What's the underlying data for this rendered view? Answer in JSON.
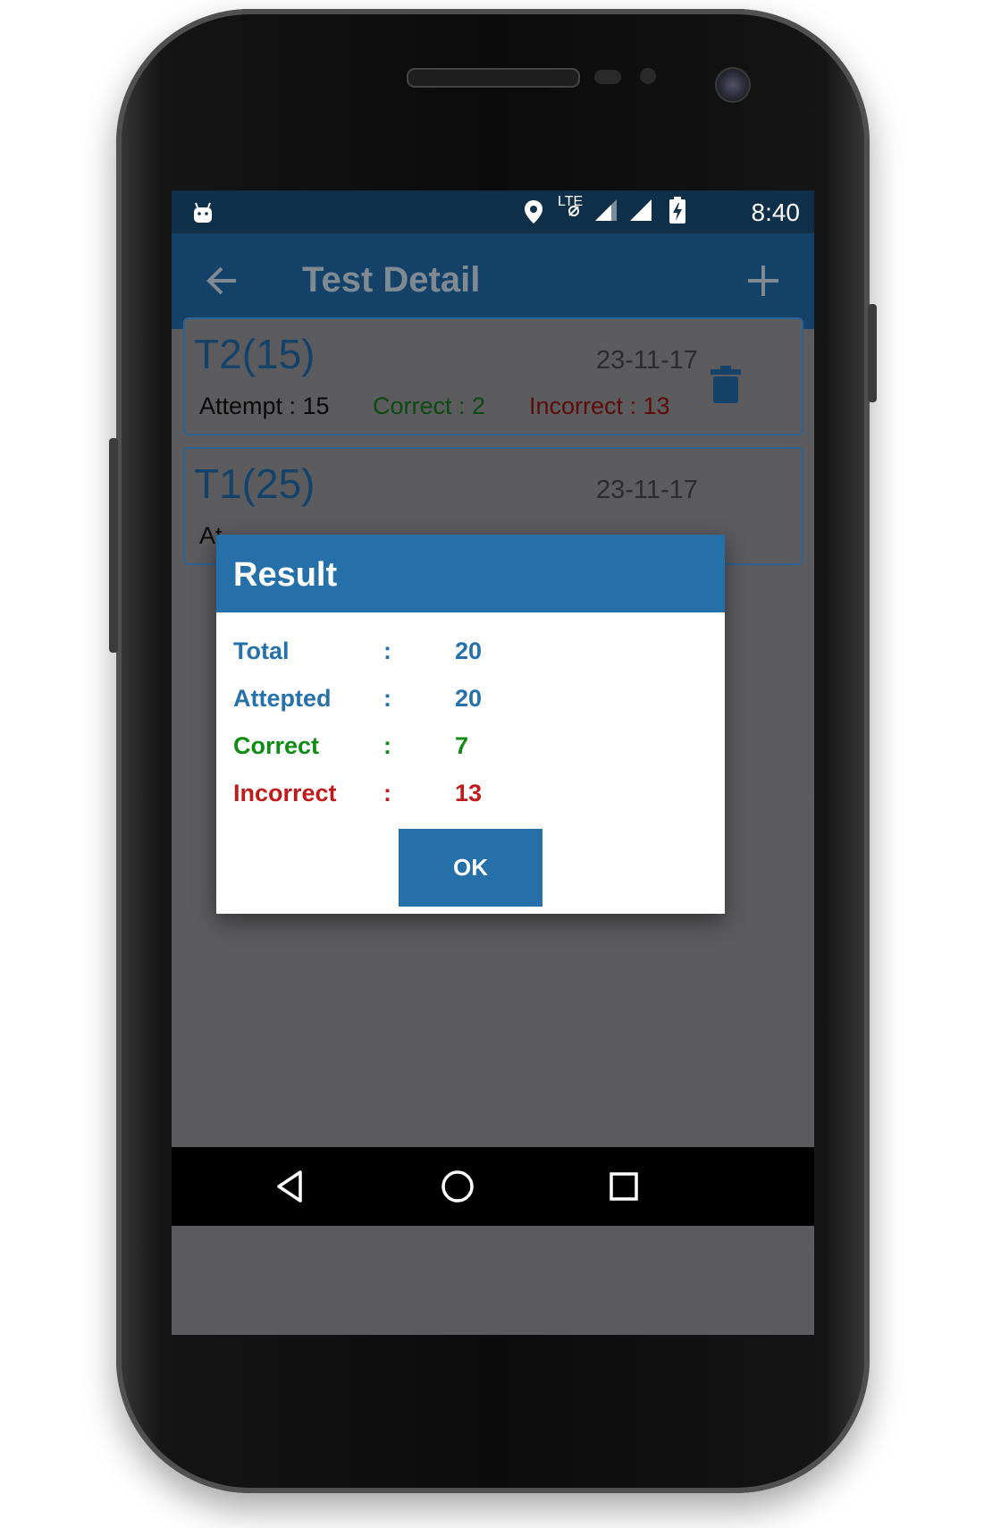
{
  "status_bar": {
    "time": "8:40",
    "network_label": "LTE",
    "icons": [
      "android-icon",
      "location-icon",
      "lte-icon",
      "signal-icon",
      "signal-full-icon",
      "battery-charging-icon"
    ]
  },
  "appbar": {
    "title": "Test Detail",
    "back_icon": "arrow-left-icon",
    "add_icon": "plus-icon"
  },
  "tests": [
    {
      "name": "T2(15)",
      "date": "23-11-17",
      "attempt": "Attempt : 15",
      "correct": "Correct : 2",
      "incorrect": "Incorrect : 13"
    },
    {
      "name": "T1(25)",
      "date": "23-11-17",
      "attempt": "At"
    }
  ],
  "dialog": {
    "title": "Result",
    "separator": ":",
    "rows": [
      {
        "label": "Total",
        "value": "20",
        "color": "#2671a9"
      },
      {
        "label": "Attepted",
        "value": "20",
        "color": "#2671a9"
      },
      {
        "label": "Correct",
        "value": "7",
        "color": "#0f8c13"
      },
      {
        "label": "Incorrect",
        "value": "13",
        "color": "#bf1b1b"
      }
    ],
    "ok_label": "OK"
  },
  "navbar": {
    "icons": [
      "back-triangle-icon",
      "home-circle-icon",
      "recents-square-icon"
    ]
  },
  "colors": {
    "appbar": "#144269",
    "statusbar": "#0f3048",
    "accent": "#2670a9",
    "correct": "#0f8c13",
    "incorrect": "#bf1b1b"
  }
}
